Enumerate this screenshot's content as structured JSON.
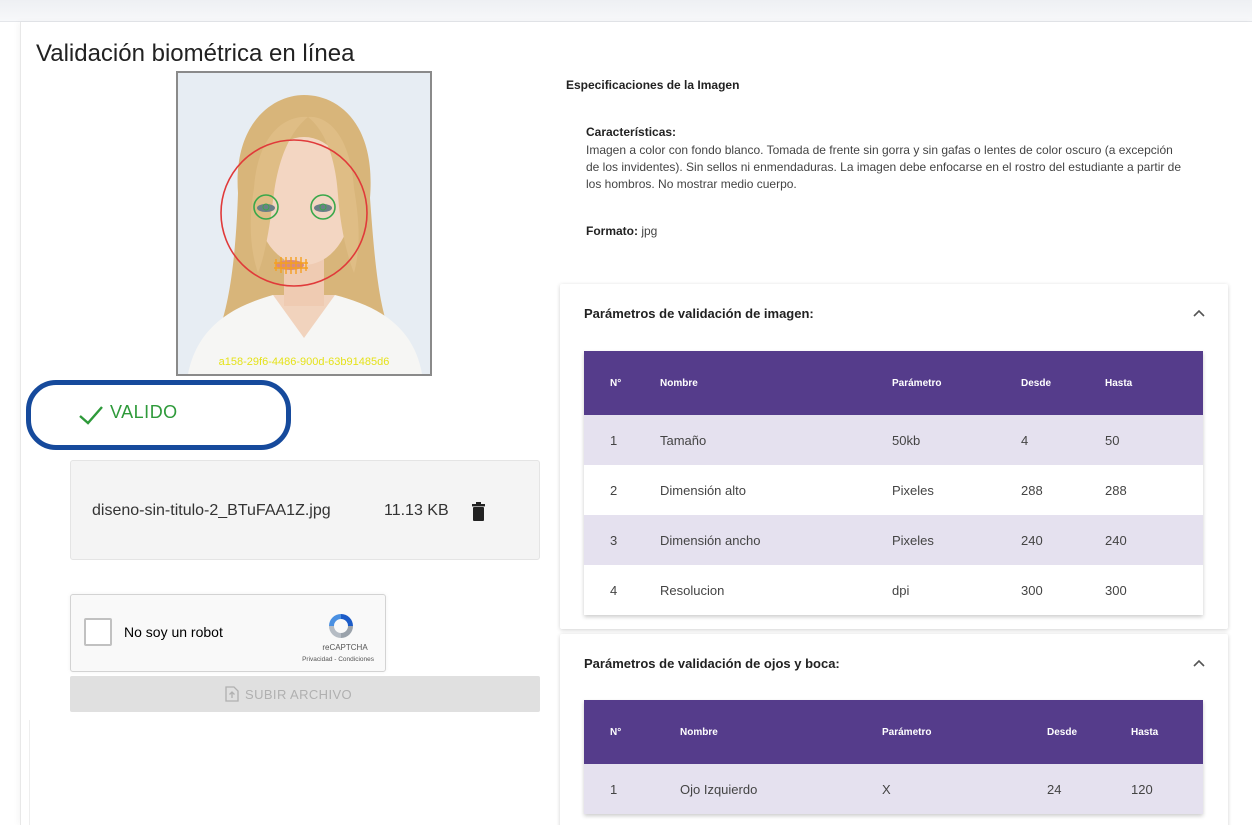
{
  "page": {
    "title": "Validación biométrica en línea"
  },
  "photo": {
    "id_text": "a158-29f6-4486-900d-63b91485d6",
    "colors": {
      "face_circle": "#e03a3a",
      "eye_markers": "#3aa84a",
      "mouth_markers": "#f5a020",
      "id_text": "#e5e21b"
    }
  },
  "status": {
    "label": "VALIDO",
    "color": "#2e9a3a",
    "highlight_color": "#164a9c"
  },
  "file": {
    "name": "diseno-sin-titulo-2_BTuFAA1Z.jpg",
    "size": "11.13 KB",
    "icon": "trash-icon"
  },
  "captcha": {
    "label": "No soy un robot",
    "brand": "reCAPTCHA",
    "links": "Privacidad - Condiciones"
  },
  "upload": {
    "label": "SUBIR ARCHIVO",
    "icon": "upload-file-icon",
    "disabled": true
  },
  "specs": {
    "title": "Especificaciones de la Imagen",
    "characteristics_label": "Características:",
    "characteristics_text": "Imagen a color con fondo blanco. Tomada de frente sin gorra y sin gafas o lentes de color oscuro (a excepción de los invidentes). Sin sellos ni enmendaduras. La imagen debe enfocarse en el rostro del estudiante a partir de los hombros. No mostrar medio cuerpo.",
    "format_label": "Formato:",
    "format_value": "jpg"
  },
  "image_params": {
    "title": "Parámetros de validación de imagen:",
    "headers": [
      "N°",
      "Nombre",
      "Parámetro",
      "Desde",
      "Hasta"
    ],
    "rows": [
      [
        "1",
        "Tamaño",
        "50kb",
        "4",
        "50"
      ],
      [
        "2",
        "Dimensión alto",
        "Pixeles",
        "288",
        "288"
      ],
      [
        "3",
        "Dimensión ancho",
        "Pixeles",
        "240",
        "240"
      ],
      [
        "4",
        "Resolucion",
        "dpi",
        "300",
        "300"
      ]
    ]
  },
  "eye_params": {
    "title": "Parámetros de validación de ojos y boca:",
    "headers": [
      "N°",
      "Nombre",
      "Parámetro",
      "Desde",
      "Hasta"
    ],
    "rows": [
      [
        "1",
        "Ojo Izquierdo",
        "X",
        "24",
        "120"
      ]
    ]
  },
  "colors": {
    "table_header": "#553c8b",
    "row_alt": "#e5e1ef"
  }
}
